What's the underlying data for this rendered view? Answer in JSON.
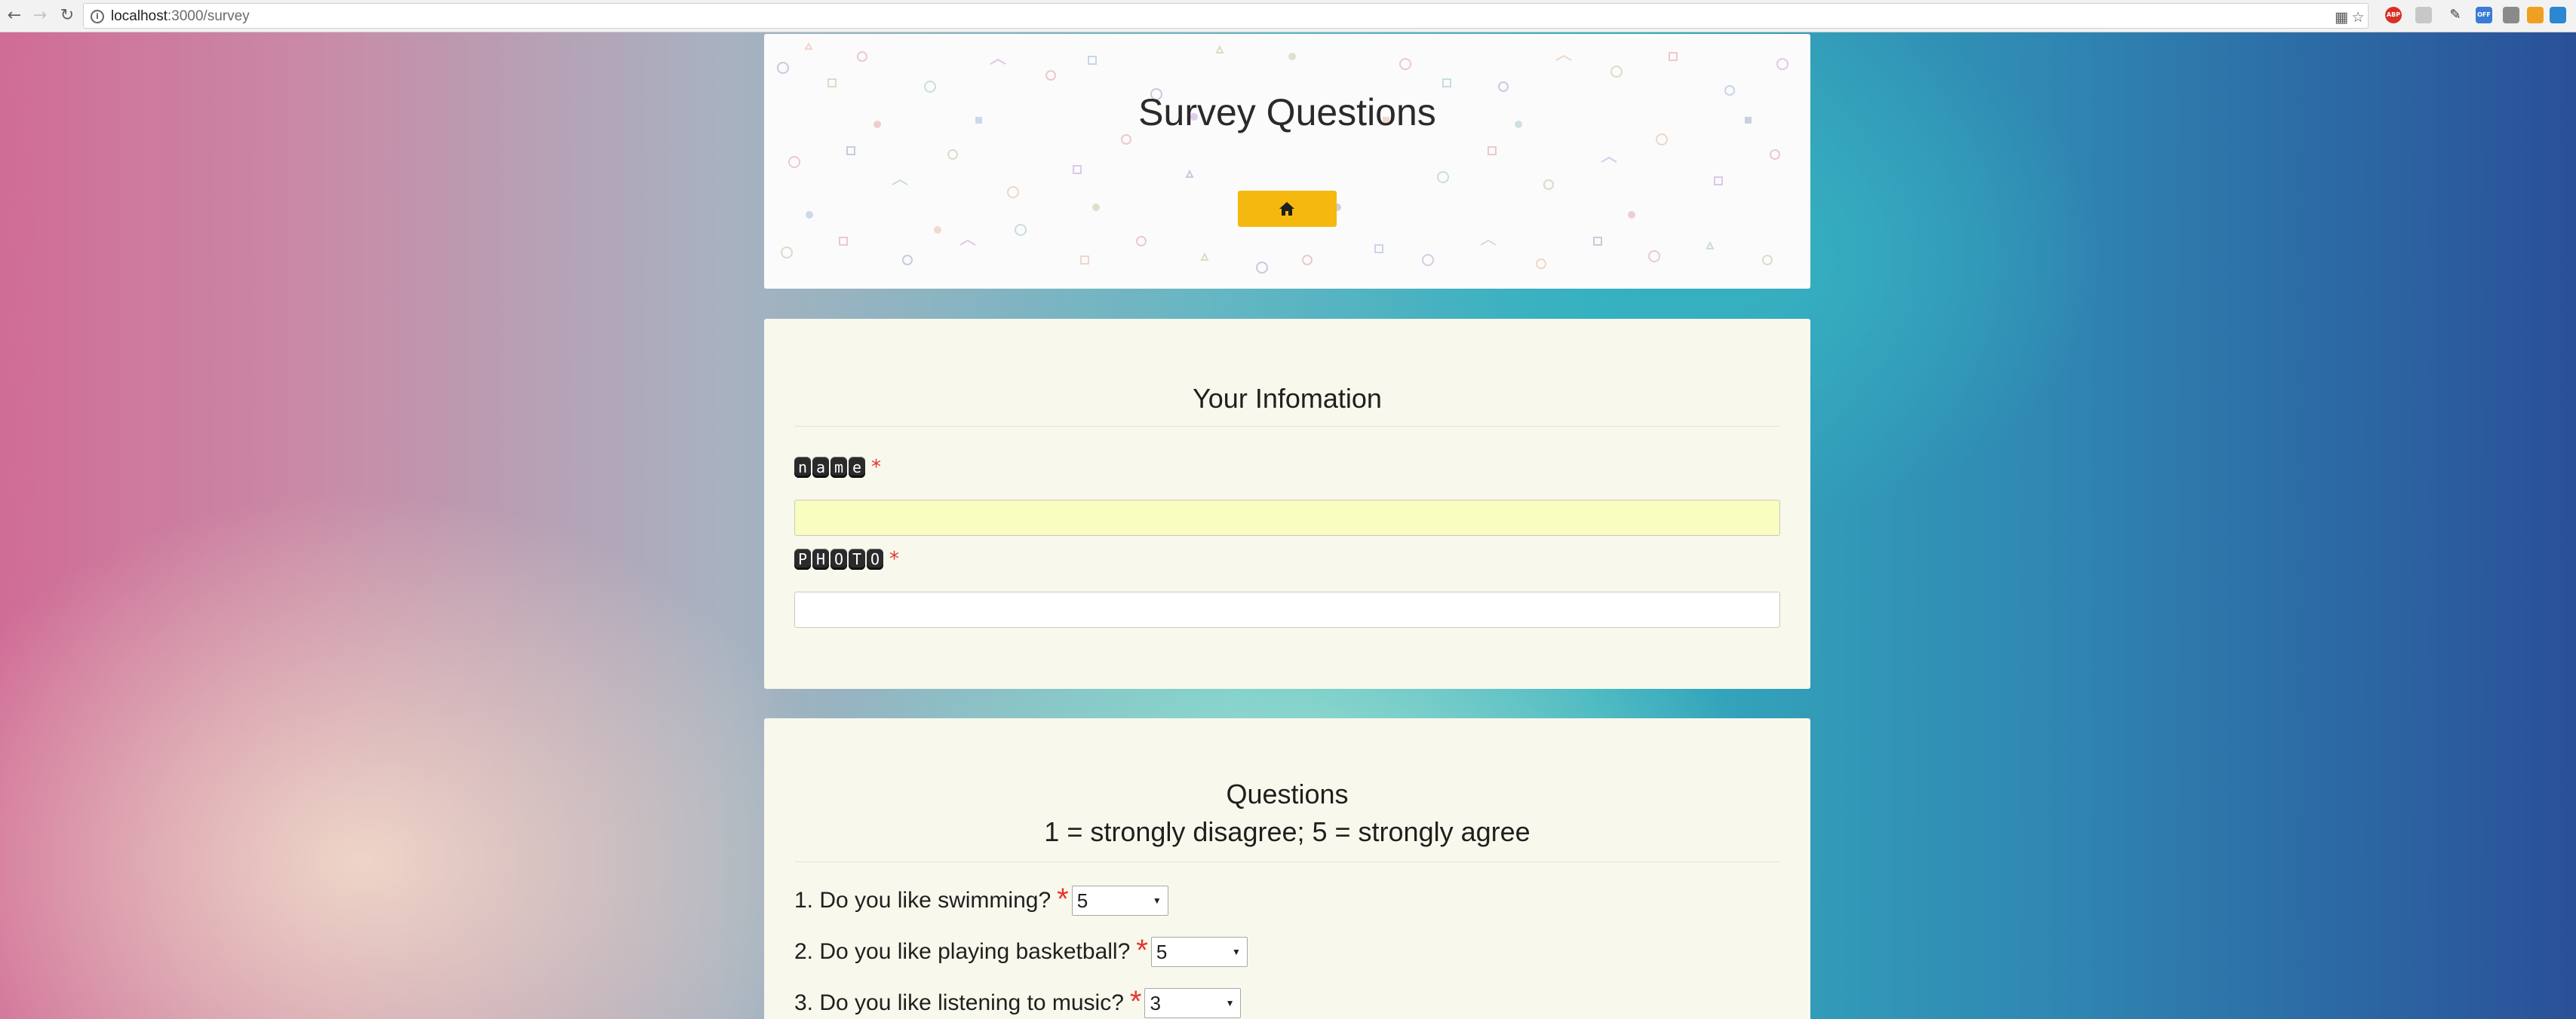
{
  "browser": {
    "url_host": "localhost",
    "url_path": ":3000/survey",
    "extensions": [
      {
        "name": "translate-icon",
        "color": "#555555",
        "text": ""
      },
      {
        "name": "bookmark-star-icon",
        "color": "#555555",
        "text": ""
      },
      {
        "name": "adblock-icon",
        "color": "#d93025",
        "text": "ABP"
      },
      {
        "name": "extension-gray-icon",
        "color": "#b0b0b0",
        "text": ""
      },
      {
        "name": "pen-extension-icon",
        "color": "#3a3a3a",
        "text": ""
      },
      {
        "name": "off-extension-icon",
        "color": "#3a7bd5",
        "text": "OFF"
      },
      {
        "name": "grid-extension-icon",
        "color": "#6b6b6b",
        "text": ""
      },
      {
        "name": "jump-extension-icon",
        "color": "#f0a020",
        "text": ""
      },
      {
        "name": "sync-extension-icon",
        "color": "#2b87d1",
        "text": ""
      }
    ]
  },
  "header": {
    "title": "Survey Questions",
    "home_icon": "home-icon",
    "button_color": "#f5b80f"
  },
  "info": {
    "title": "Your Infomation",
    "name_label": [
      "n",
      "a",
      "m",
      "e"
    ],
    "photo_label": [
      "P",
      "H",
      "O",
      "T",
      "O"
    ],
    "required_mark": "*",
    "name_value": "",
    "photo_value": ""
  },
  "questions": {
    "title": "Questions",
    "subtitle": "1 = strongly disagree; 5 = strongly agree",
    "required_mark": "*",
    "items": [
      {
        "text": "1. Do you like swimming?",
        "value": "5"
      },
      {
        "text": "2. Do you like playing basketball?",
        "value": "5"
      },
      {
        "text": "3. Do you like listening to music?",
        "value": "3"
      }
    ]
  }
}
